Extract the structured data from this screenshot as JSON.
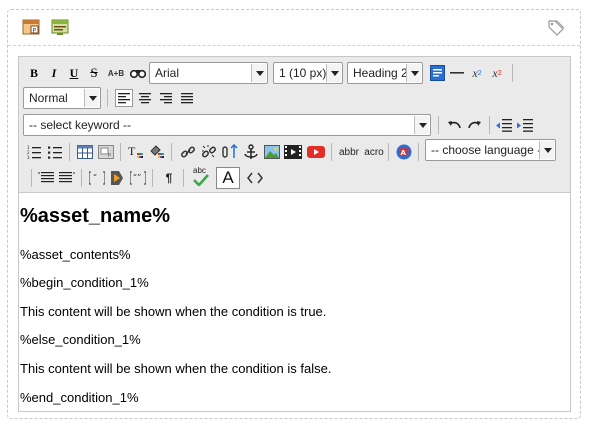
{
  "toolbar": {
    "font_family": "Arial",
    "font_size": "1 (10 px)",
    "heading": "Heading 2",
    "paragraph_style": "Normal",
    "keyword": "-- select keyword --",
    "language": "-- choose language --",
    "abbr_label": "abbr",
    "acro_label": "acro",
    "spell_label": "abc",
    "text_color_label": "A",
    "subscript_label": "x",
    "superscript_label": "x",
    "strike_label": "S",
    "bold_label": "B",
    "italic_label": "I",
    "underline_label": "U",
    "strike_ab_label": "A+B"
  },
  "content": {
    "title": "%asset_name%",
    "paragraphs": [
      "%asset_contents%",
      "%begin_condition_1%",
      "This content will be shown when the condition is true.",
      "%else_condition_1%",
      "This content will be shown when the condition is false.",
      "%end_condition_1%"
    ]
  },
  "colors": {
    "toolbar_bg": "#eaeaea",
    "accent_blue": "#2b6fd6",
    "youtube_red": "#e52d27"
  }
}
